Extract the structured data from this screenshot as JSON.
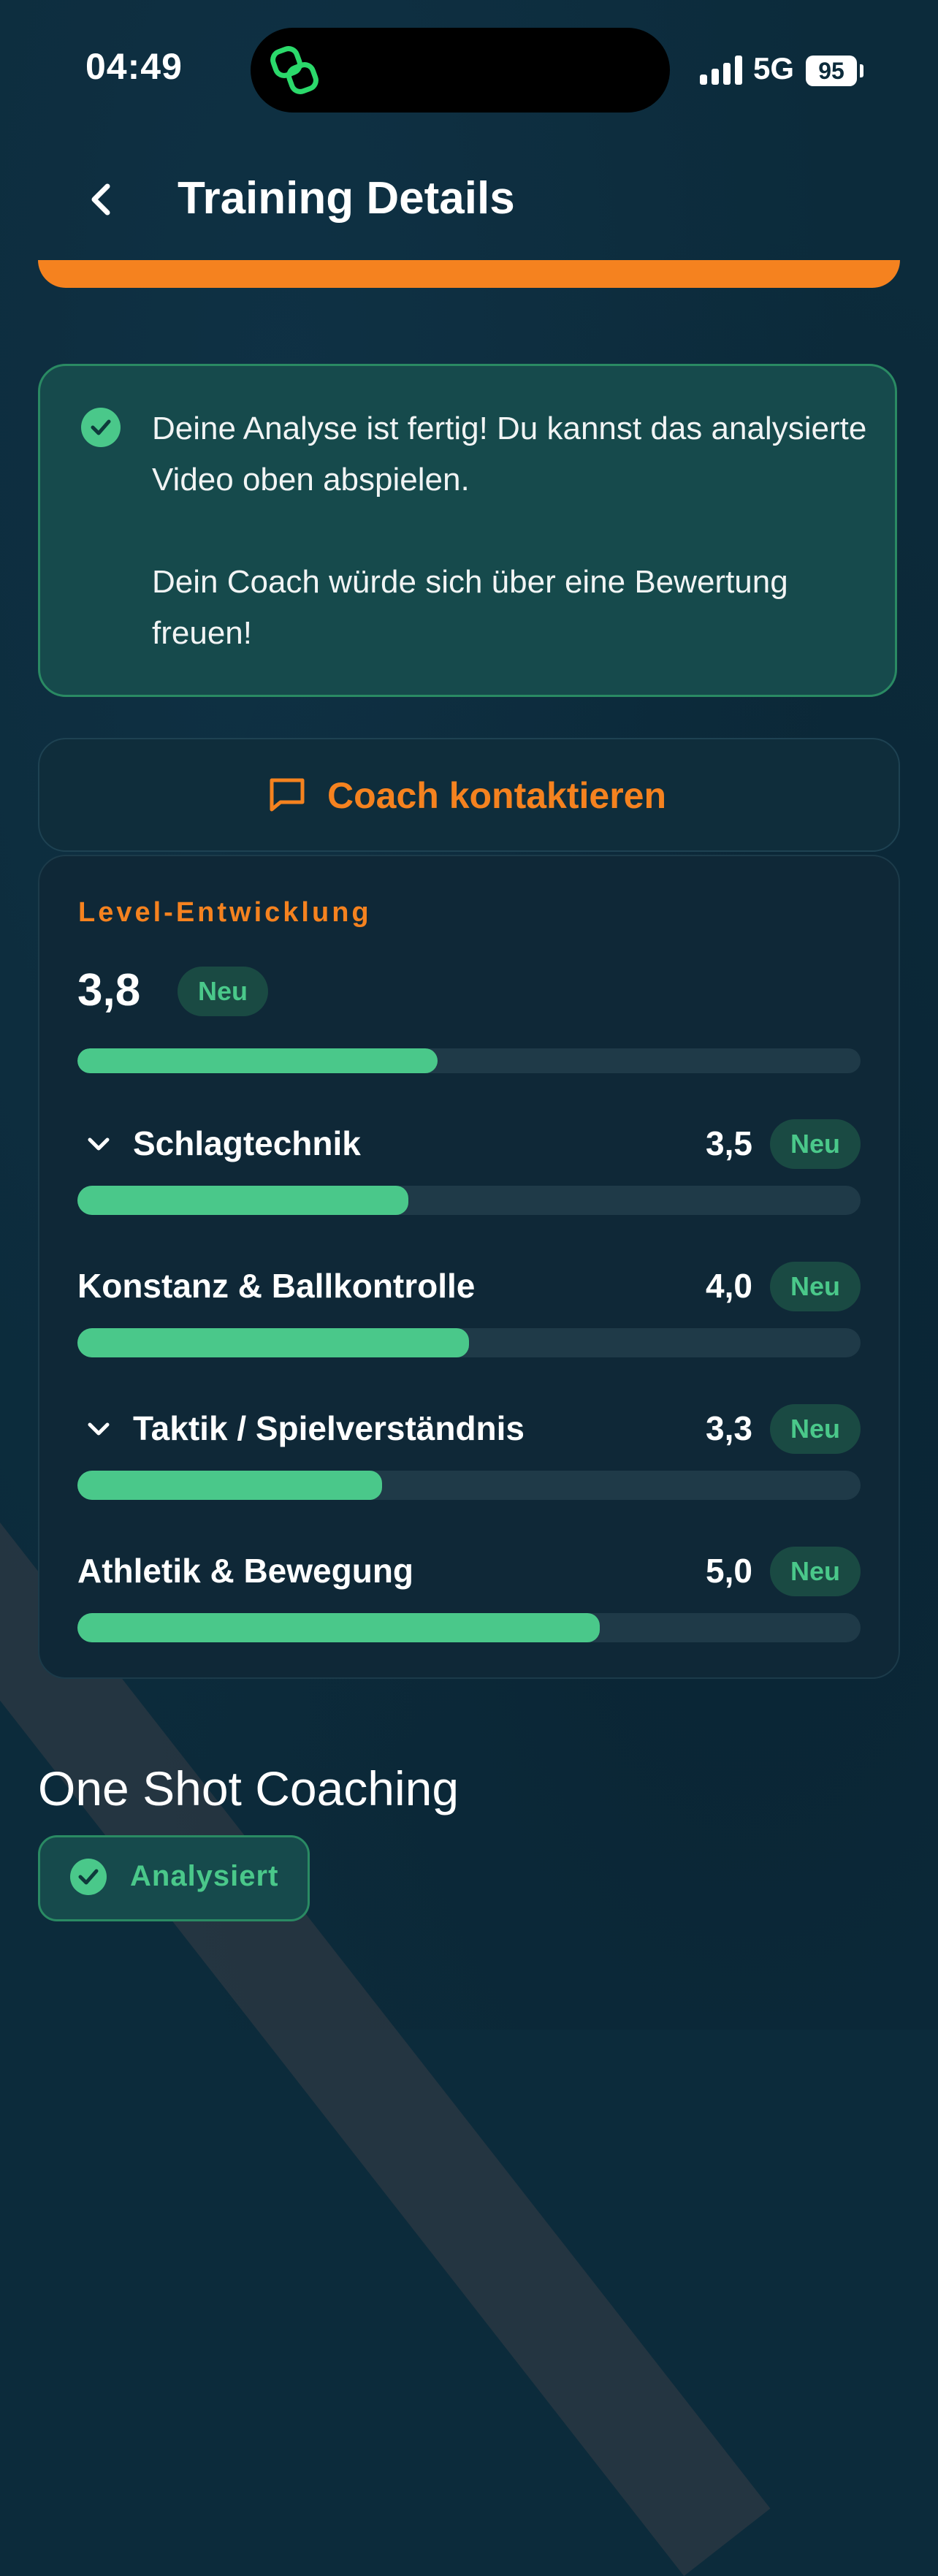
{
  "status_bar": {
    "time": "04:49",
    "network": "5G",
    "battery": "95"
  },
  "header": {
    "title": "Training Details",
    "back_icon": "chevron-left-icon"
  },
  "notice": {
    "icon": "check-circle-icon",
    "line1": "Deine Analyse ist fertig! Du kannst das analysierte Video oben abspielen.",
    "line2": "Dein Coach würde sich über eine Bewertung freuen!"
  },
  "coach_button": {
    "icon": "chat-bubble-icon",
    "label": "Coach kontaktieren"
  },
  "level": {
    "title": "Level-Entwicklung",
    "value": "3,8",
    "badge": "Neu",
    "progress": 0.46,
    "categories": [
      {
        "label": "Schlagtechnik",
        "value": "3,5",
        "badge": "Neu",
        "progress": 0.423,
        "expandable": true
      },
      {
        "label": "Konstanz & Ballkontrolle",
        "value": "4,0",
        "badge": "Neu",
        "progress": 0.5,
        "expandable": false
      },
      {
        "label": "Taktik / Spielverständnis",
        "value": "3,3",
        "badge": "Neu",
        "progress": 0.389,
        "expandable": true
      },
      {
        "label": "Athletik & Bewegung",
        "value": "5,0",
        "badge": "Neu",
        "progress": 0.667,
        "expandable": false
      }
    ]
  },
  "one_shot": {
    "title": "One Shot Coaching",
    "status_label": "Analysiert",
    "status_icon": "check-circle-icon"
  },
  "colors": {
    "background": "#0c2b3b",
    "accent_orange": "#f5821f",
    "accent_green": "#4ac88a"
  }
}
